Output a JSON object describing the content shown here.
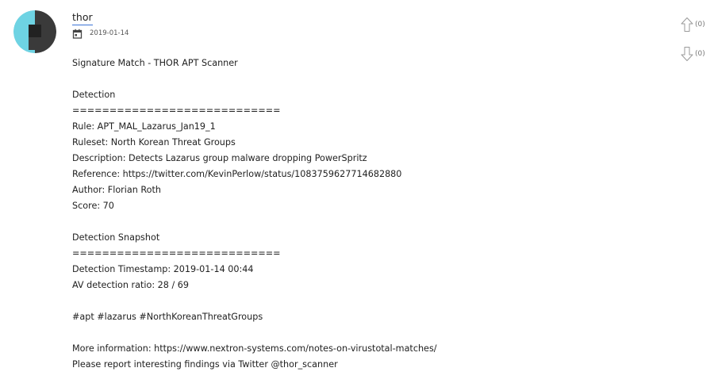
{
  "comment": {
    "author": "thor",
    "date": "2019-01-14",
    "avatar_icon": "thor-avatar-icon",
    "calendar_icon": "calendar-icon",
    "votes": {
      "up_label": "(0)",
      "down_label": "(0)",
      "up_icon": "arrow-up-icon",
      "down_icon": "arrow-down-icon"
    },
    "body": [
      "Signature Match - THOR APT Scanner",
      "",
      "Detection",
      "============================",
      "Rule: APT_MAL_Lazarus_Jan19_1",
      "Ruleset: North Korean Threat Groups",
      "Description: Detects Lazarus group malware dropping PowerSpritz",
      "Reference: https://twitter.com/KevinPerlow/status/1083759627714682880",
      "Author: Florian Roth",
      "Score: 70",
      "",
      "Detection Snapshot",
      "============================",
      "Detection Timestamp: 2019-01-14 00:44",
      "AV detection ratio: 28 / 69",
      "",
      "#apt #lazarus #NorthKoreanThreatGroups",
      "",
      "More information: https://www.nextron-systems.com/notes-on-virustotal-matches/",
      "Please report interesting findings via Twitter @thor_scanner"
    ]
  },
  "colors": {
    "avatar_cyan": "#6ed3e3",
    "avatar_dark": "#3a3a3a",
    "link_underline": "#3b73d6"
  }
}
